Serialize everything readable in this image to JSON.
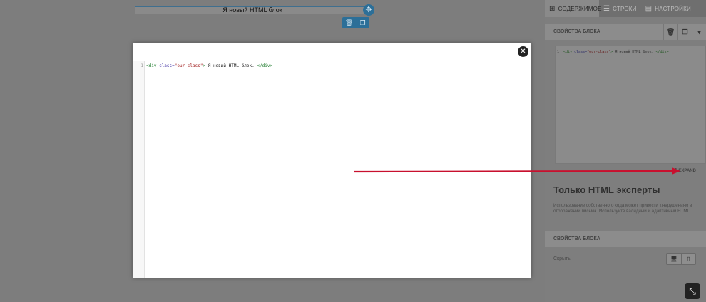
{
  "canvas": {
    "block_text": "Я новый HTML блок",
    "toolbar": {
      "delete_icon": "trash-icon",
      "duplicate_icon": "copy-icon"
    }
  },
  "modal": {
    "close_icon": "close-icon",
    "editor": {
      "line_number": "1",
      "code_tokens": {
        "open_tag": "<div ",
        "attr_name": "class=",
        "attr_value": "\"our-class\"",
        "tag_close": "> ",
        "text": "Я новый HTML блок. ",
        "end_tag": "</div>"
      }
    }
  },
  "sidebar": {
    "tabs": [
      {
        "label": "СОДЕРЖИМОЕ",
        "icon": "grid-icon",
        "active": true
      },
      {
        "label": "СТРОКИ",
        "icon": "rows-icon",
        "active": false
      },
      {
        "label": "НАСТРОЙКИ",
        "icon": "settings-icon",
        "active": false
      }
    ],
    "block_properties_title": "СВОЙСТВА БЛОКА",
    "code_preview": {
      "line_number": "1",
      "code_tokens": {
        "open_tag": "<div ",
        "attr_name": "class=",
        "attr_value": "\"our-class\"",
        "tag_close": "> ",
        "text": "Я новый HTML блок. ",
        "end_tag": "</div>"
      }
    },
    "expand_label": "EXPAND",
    "warning_title": "Только HTML эксперты",
    "warning_text": "Использование собственного кода может привести к нарушениям в отображении письма. Используйте валидный и адаптивный HTML.",
    "block_properties_title_2": "СВОЙСТВА БЛОКА",
    "hide_label": "Скрыть"
  },
  "colors": {
    "annotation_arrow": "#c8102e",
    "accent": "#2c6f98"
  }
}
